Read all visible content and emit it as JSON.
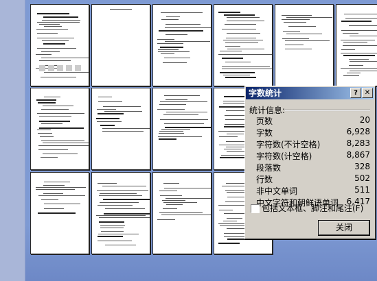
{
  "dialog": {
    "title": "字数统计",
    "help_button": "?",
    "close_x": "✕",
    "section_label": "统计信息:",
    "stats": [
      {
        "label": "页数",
        "value": "20"
      },
      {
        "label": "字数",
        "value": "6,928"
      },
      {
        "label": "字符数(不计空格)",
        "value": "8,283"
      },
      {
        "label": "字符数(计空格)",
        "value": "8,867"
      },
      {
        "label": "段落数",
        "value": "328"
      },
      {
        "label": "行数",
        "value": "502"
      },
      {
        "label": "非中文单词",
        "value": "511"
      },
      {
        "label": "中文字符和朝鲜语单词",
        "value": "6,417"
      }
    ],
    "checkbox_label": "包括文本框、脚注和尾注(F)",
    "checkbox_checked": false,
    "close_button": "关闭"
  },
  "document": {
    "view": "multi-page thumbnails",
    "page_count_visible": 16
  }
}
